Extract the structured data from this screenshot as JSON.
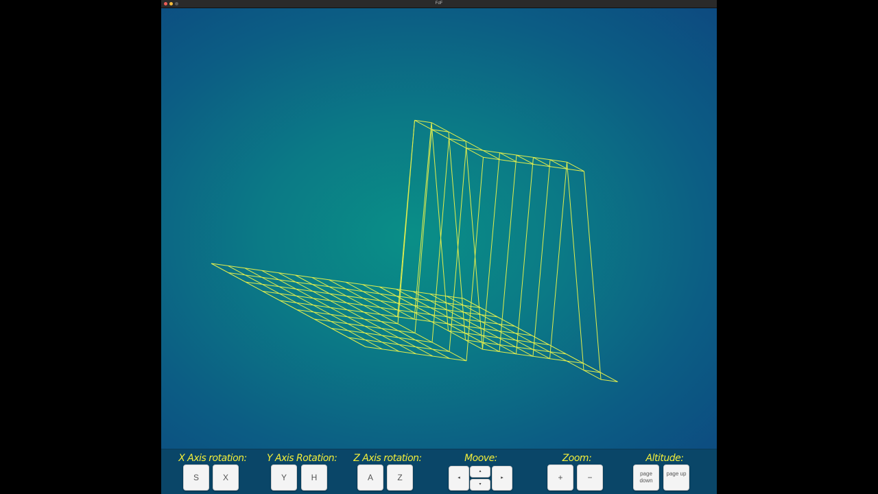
{
  "window": {
    "title": "FdF",
    "traffic_lights": {
      "close": "#ee5f58",
      "minimize": "#f6bd3b",
      "maximize": "#5a5a5a"
    }
  },
  "scene": {
    "wire_color": "#e4ef4c",
    "background_colors": [
      "#0a8f87",
      "#0d4a80"
    ],
    "grid_cols": 10,
    "grid_rows": 15,
    "heights": [
      [
        0,
        0,
        0,
        0,
        0,
        0,
        0,
        0,
        0,
        0
      ],
      [
        0,
        0,
        0,
        0,
        0,
        0,
        0,
        0,
        0,
        0
      ],
      [
        0,
        0,
        0,
        0,
        0,
        0,
        0,
        0,
        0,
        0
      ],
      [
        0,
        0,
        0,
        0,
        0,
        0,
        0,
        0,
        0,
        0
      ],
      [
        0,
        0,
        0,
        0,
        0,
        0,
        0,
        0,
        0,
        0
      ],
      [
        0,
        0,
        0,
        0,
        0,
        0,
        0,
        0,
        0,
        0
      ],
      [
        0,
        0,
        0,
        0,
        0,
        0,
        0,
        0,
        0,
        0
      ],
      [
        0,
        0,
        0,
        0,
        0,
        10,
        10,
        10,
        10,
        10
      ],
      [
        0,
        0,
        0,
        0,
        0,
        10,
        10,
        10,
        10,
        10
      ],
      [
        0,
        0,
        0,
        0,
        0,
        0,
        0,
        0,
        10,
        10
      ],
      [
        0,
        0,
        0,
        0,
        0,
        0,
        0,
        0,
        10,
        10
      ],
      [
        0,
        0,
        0,
        0,
        0,
        0,
        0,
        0,
        10,
        10
      ],
      [
        0,
        0,
        0,
        0,
        0,
        0,
        0,
        0,
        10,
        10
      ],
      [
        0,
        0,
        0,
        0,
        0,
        0,
        0,
        0,
        10,
        10
      ],
      [
        0,
        0,
        0,
        0,
        0,
        0,
        0,
        0,
        0,
        0
      ],
      [
        0,
        0,
        0,
        0,
        0,
        0,
        0,
        0,
        0,
        0
      ]
    ]
  },
  "controls": {
    "x_rotation": {
      "label": "X Axis rotation:",
      "keys": [
        "S",
        "X"
      ]
    },
    "y_rotation": {
      "label": "Y Axis Rotation:",
      "keys": [
        "Y",
        "H"
      ]
    },
    "z_rotation": {
      "label": "Z Axis rotation:",
      "keys": [
        "A",
        "Z"
      ]
    },
    "move": {
      "label": "Moove:",
      "keys": [
        "◂",
        "▴",
        "▾",
        "▸"
      ]
    },
    "zoom": {
      "label": "Zoom:",
      "keys": [
        "+",
        "−"
      ]
    },
    "altitude": {
      "label": "Altitude:",
      "keys": [
        "page down",
        "page up"
      ]
    }
  }
}
